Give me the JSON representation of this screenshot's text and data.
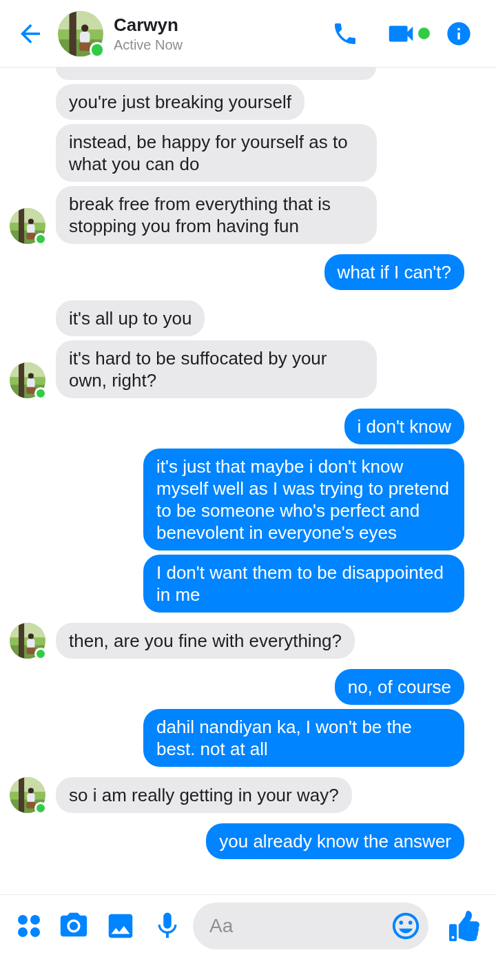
{
  "header": {
    "name": "Carwyn",
    "status": "Active Now",
    "online": true
  },
  "groups": [
    {
      "kind": "incoming",
      "online": true,
      "messages": [
        {
          "kind": "clipped"
        },
        {
          "kind": "text",
          "text": "you're just breaking yourself"
        },
        {
          "kind": "text",
          "text": "instead, be happy for yourself as to what you can do"
        },
        {
          "kind": "text",
          "text": "break free from everything that is stopping you from having fun"
        }
      ]
    },
    {
      "kind": "outgoing",
      "messages": [
        {
          "kind": "text",
          "text": "what if I can't?"
        }
      ]
    },
    {
      "kind": "incoming",
      "online": true,
      "messages": [
        {
          "kind": "text",
          "text": "it's all up to you"
        },
        {
          "kind": "text",
          "text": "it's hard to be suffocated by your own, right?"
        }
      ]
    },
    {
      "kind": "outgoing",
      "messages": [
        {
          "kind": "text",
          "text": "i don't know"
        },
        {
          "kind": "text",
          "text": "it's just that maybe i don't know myself well as I was trying to pretend to be someone who's perfect and benevolent in everyone's eyes"
        },
        {
          "kind": "text",
          "text": "I don't want them to be disappointed in me"
        }
      ]
    },
    {
      "kind": "incoming",
      "online": true,
      "messages": [
        {
          "kind": "text",
          "text": "then, are you fine with everything?"
        }
      ]
    },
    {
      "kind": "outgoing",
      "messages": [
        {
          "kind": "text",
          "text": "no, of course"
        },
        {
          "kind": "text",
          "text": "dahil nandiyan ka, I won't be the best. not at all"
        }
      ]
    },
    {
      "kind": "incoming",
      "online": true,
      "messages": [
        {
          "kind": "text",
          "text": "so i am really getting in your way?"
        }
      ]
    },
    {
      "kind": "outgoing",
      "messages": [
        {
          "kind": "text",
          "text": "you already know the answer"
        }
      ]
    }
  ],
  "composer": {
    "placeholder": "Aa"
  }
}
